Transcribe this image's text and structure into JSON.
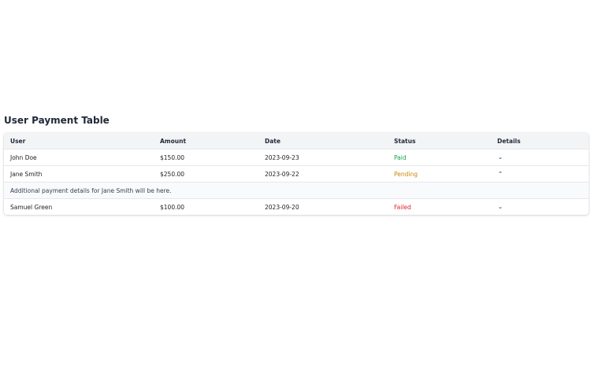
{
  "title": "User Payment Table",
  "columns": {
    "user": "User",
    "amount": "Amount",
    "date": "Date",
    "status": "Status",
    "details": "Details"
  },
  "rows": [
    {
      "user": "John Doe",
      "amount": "$150.00",
      "date": "2023-09-23",
      "status": "Paid",
      "toggle": "⌄"
    },
    {
      "user": "Jane Smith",
      "amount": "$250.00",
      "date": "2023-09-22",
      "status": "Pending",
      "toggle": "⌃"
    },
    {
      "user": "Samuel Green",
      "amount": "$100.00",
      "date": "2023-09-20",
      "status": "Failed",
      "toggle": "⌄"
    }
  ],
  "expanded_details": {
    "text": "Additional payment details for Jane Smith will be here."
  },
  "colors": {
    "paid": "#16a34a",
    "pending": "#ca8a04",
    "failed": "#dc2626",
    "header_bg": "#f3f4f6"
  },
  "icons": {
    "expand": "chevron-down-icon",
    "collapse": "chevron-up-icon"
  }
}
